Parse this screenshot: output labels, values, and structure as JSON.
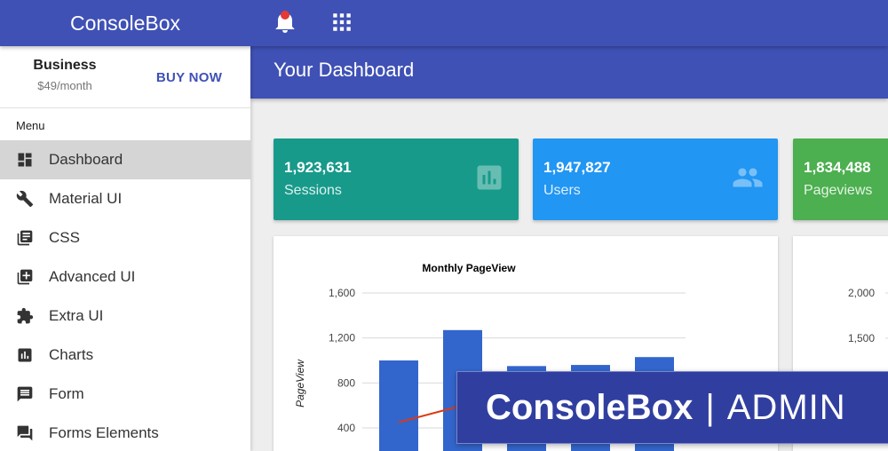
{
  "app": {
    "brand": "ConsoleBox"
  },
  "topbar": {
    "icons": [
      "bell-icon",
      "apps-grid-icon"
    ]
  },
  "plan": {
    "name": "Business",
    "price": "$49/month",
    "cta": "BUY NOW"
  },
  "sidebar": {
    "menu_label": "Menu",
    "items": [
      {
        "label": "Dashboard",
        "icon": "dashboard-icon",
        "active": true
      },
      {
        "label": "Material UI",
        "icon": "wrench-icon"
      },
      {
        "label": "CSS",
        "icon": "library-icon"
      },
      {
        "label": "Advanced UI",
        "icon": "add-box-icon"
      },
      {
        "label": "Extra UI",
        "icon": "puzzle-icon"
      },
      {
        "label": "Charts",
        "icon": "chart-icon"
      },
      {
        "label": "Form",
        "icon": "comment-icon"
      },
      {
        "label": "Forms Elements",
        "icon": "forum-icon"
      }
    ]
  },
  "header": {
    "title": "Your Dashboard"
  },
  "stats": [
    {
      "value": "1,923,631",
      "label": "Sessions",
      "icon": "bar-chart-icon",
      "color": "#179a8a"
    },
    {
      "value": "1,947,827",
      "label": "Users",
      "icon": "people-icon",
      "color": "#2196f3"
    },
    {
      "value": "1,834,488",
      "label": "Pageviews",
      "icon": "",
      "color": "#4caf50"
    }
  ],
  "colors": {
    "primary": "#3f51b5",
    "bar": "#3366cc",
    "line": "#dc3912"
  },
  "chart_data": [
    {
      "type": "bar",
      "title": "Monthly PageView",
      "ylabel": "PageView",
      "ylim": [
        0,
        1700
      ],
      "yticks": [
        "400",
        "800",
        "1,200",
        "1,600"
      ],
      "ytick_values": [
        400,
        800,
        1200,
        1600
      ],
      "values": [
        1000,
        1270,
        950,
        960,
        1030
      ],
      "line_values": [
        450,
        600,
        null,
        null,
        null
      ]
    },
    {
      "type": "bar",
      "yticks": [
        "1,500",
        "2,000"
      ],
      "ytick_values": [
        1500,
        2000
      ]
    }
  ],
  "banner": {
    "brand": "ConsoleBox",
    "separator": "|",
    "suffix": "ADMIN"
  }
}
